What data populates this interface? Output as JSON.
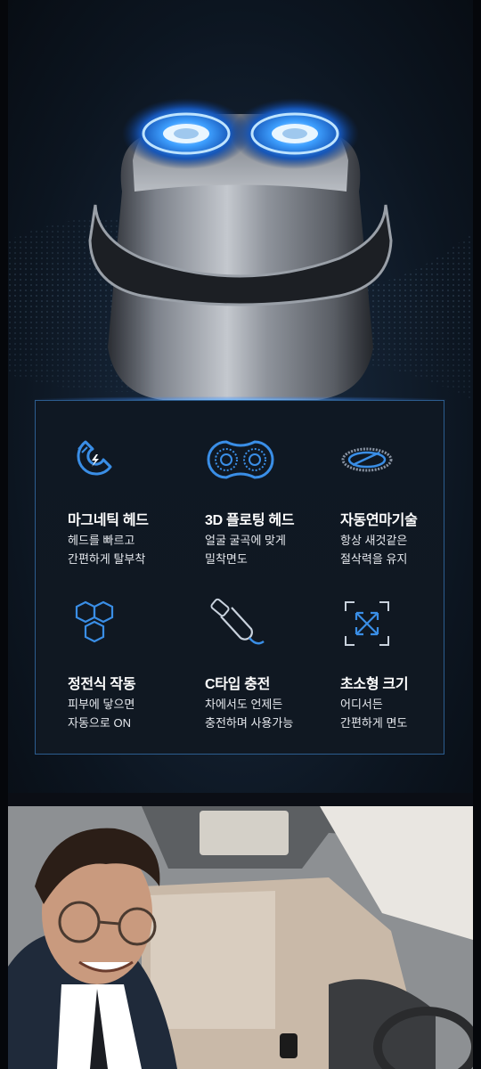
{
  "features": [
    {
      "title": "마그네틱 헤드",
      "line1": "헤드를 빠르고",
      "line2": "간편하게 탈부착",
      "icon": "magnet-icon"
    },
    {
      "title": "3D 플로팅 헤드",
      "line1": "얼굴 굴곡에 맞게",
      "line2": "밀착면도",
      "icon": "dual-head-icon"
    },
    {
      "title": "자동연마기술",
      "line1": "항상 새것같은",
      "line2": "절삭력을 유지",
      "icon": "blade-ring-icon"
    },
    {
      "title": "정전식 작동",
      "line1": "피부에 닿으면",
      "line2": "자동으로 ON",
      "icon": "hexagon-cluster-icon"
    },
    {
      "title": "C타입 충전",
      "line1": "차에서도 언제든",
      "line2": "충전하며 사용가능",
      "icon": "usb-c-cable-icon"
    },
    {
      "title": "초소형 크기",
      "line1": "어디서든",
      "line2": "간편하게 면도",
      "icon": "expand-arrows-icon"
    }
  ],
  "colors": {
    "accent": "#3a8ee6",
    "panel_border": "#2c5d8f",
    "background": "#0b0e15"
  }
}
